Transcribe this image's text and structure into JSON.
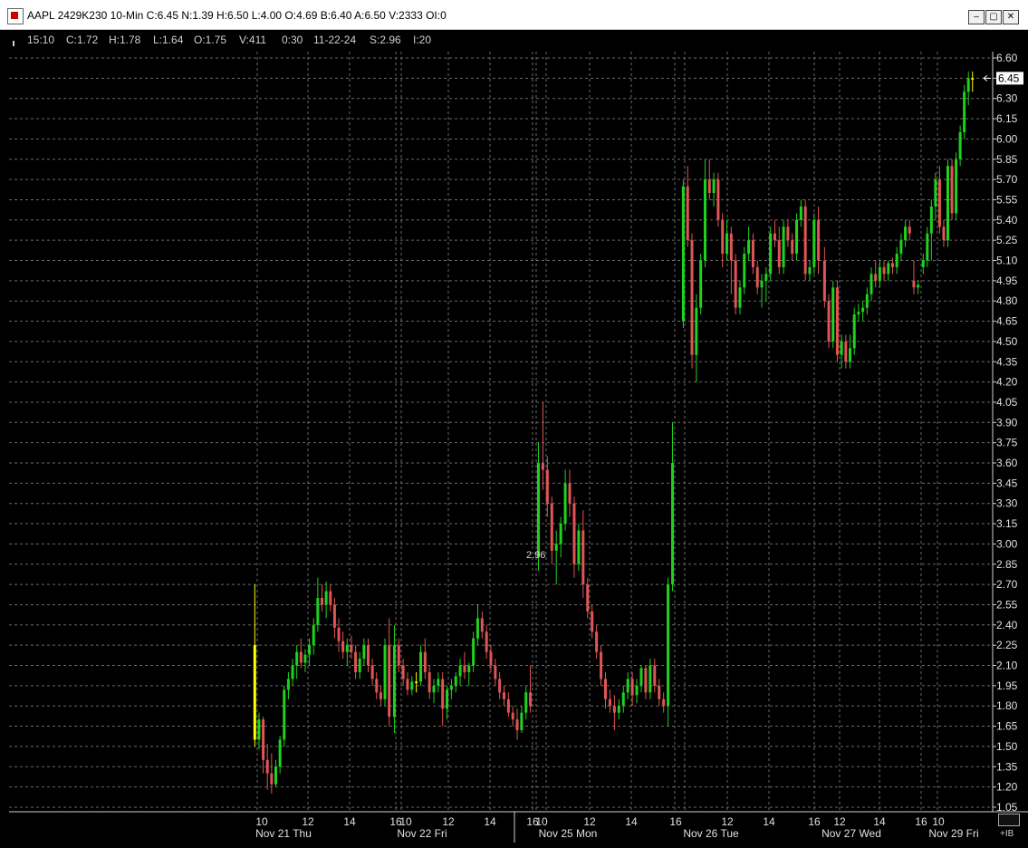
{
  "window": {
    "title": "AAPL 2429K230 10-Min C:6.45 N:1.39 H:6.50 L:4.00 O:4.69 B:6.40 A:6.50 V:2333 OI:0",
    "buttons": {
      "minimize": "‒",
      "maximize": "▢",
      "close": "✕"
    }
  },
  "info": {
    "time": "15:10",
    "close": "C:1.72",
    "high": "H:1.78",
    "low": "L:1.64",
    "open": "O:1.75",
    "volume": "V:411",
    "bar_interval": "0:30",
    "date": "11-22-24",
    "settle": "S:2.96",
    "index": "I:20"
  },
  "corner": {
    "label": "+IB"
  },
  "chart_data": {
    "type": "candlestick",
    "title": "",
    "xlabel": "",
    "ylabel": "",
    "ylim": [
      1.0,
      6.65
    ],
    "y_ticks": [
      "6.60",
      "6.45",
      "6.30",
      "6.15",
      "6.00",
      "5.85",
      "5.70",
      "5.55",
      "5.40",
      "5.25",
      "5.10",
      "4.95",
      "4.80",
      "4.65",
      "4.50",
      "4.35",
      "4.20",
      "4.05",
      "3.90",
      "3.75",
      "3.60",
      "3.45",
      "3.30",
      "3.15",
      "3.00",
      "2.85",
      "2.70",
      "2.55",
      "2.40",
      "2.25",
      "2.10",
      "1.95",
      "1.80",
      "1.65",
      "1.50",
      "1.35",
      "1.20",
      "1.05"
    ],
    "last_price": "6.45",
    "annotation": "2.96",
    "colors": {
      "up": "#1ed31e",
      "down": "#e05555",
      "doji": "#ffff00",
      "grid": "#6a6a6a",
      "text": "#e0e0e0"
    },
    "x_time_labels": [
      "10",
      "12",
      "14",
      "16",
      "10",
      "12",
      "14",
      "16",
      "10",
      "12",
      "14",
      "16",
      "12",
      "14",
      "16",
      "12",
      "14",
      "16",
      "10"
    ],
    "x_day_labels": [
      "Nov 21 Thu",
      "Nov 22 Fri",
      "Nov 25 Mon",
      "Nov 26 Tue",
      "Nov 27 Wed",
      "Nov 29 Fri"
    ],
    "sessions": [
      {
        "name": "Nov 21 Thu",
        "bars": [
          [
            2.25,
            2.7,
            1.5,
            1.55
          ],
          [
            1.55,
            1.75,
            1.48,
            1.7
          ],
          [
            1.7,
            1.72,
            1.3,
            1.4
          ],
          [
            1.4,
            1.52,
            1.18,
            1.3
          ],
          [
            1.3,
            1.45,
            1.15,
            1.22
          ],
          [
            1.22,
            1.4,
            1.2,
            1.35
          ],
          [
            1.35,
            1.58,
            1.3,
            1.55
          ],
          [
            1.55,
            1.95,
            1.5,
            1.92
          ],
          [
            1.92,
            2.05,
            1.85,
            2.0
          ],
          [
            2.0,
            2.15,
            1.95,
            2.1
          ],
          [
            2.1,
            2.25,
            2.0,
            2.2
          ],
          [
            2.2,
            2.3,
            2.08,
            2.12
          ],
          [
            2.12,
            2.22,
            2.05,
            2.18
          ],
          [
            2.18,
            2.3,
            2.1,
            2.25
          ],
          [
            2.25,
            2.45,
            2.18,
            2.4
          ],
          [
            2.4,
            2.75,
            2.35,
            2.6
          ],
          [
            2.6,
            2.7,
            2.5,
            2.55
          ],
          [
            2.55,
            2.72,
            2.45,
            2.65
          ],
          [
            2.65,
            2.7,
            2.5,
            2.55
          ],
          [
            2.55,
            2.6,
            2.3,
            2.38
          ],
          [
            2.38,
            2.45,
            2.2,
            2.28
          ],
          [
            2.28,
            2.35,
            2.15,
            2.2
          ],
          [
            2.2,
            2.3,
            2.1,
            2.25
          ],
          [
            2.25,
            2.32,
            2.15,
            2.2
          ],
          [
            2.2,
            2.25,
            2.0,
            2.05
          ],
          [
            2.05,
            2.2,
            2.0,
            2.15
          ],
          [
            2.15,
            2.3,
            2.1,
            2.25
          ],
          [
            2.25,
            2.3,
            2.05,
            2.1
          ],
          [
            2.1,
            2.15,
            1.95,
            2.0
          ],
          [
            2.0,
            2.05,
            1.85,
            1.9
          ],
          [
            1.9,
            1.95,
            1.8,
            1.85
          ],
          [
            1.85,
            2.3,
            1.8,
            2.25
          ],
          [
            2.25,
            2.45,
            1.65,
            1.72
          ]
        ]
      },
      {
        "name": "Nov 22 Fri",
        "bars": [
          [
            1.72,
            2.4,
            1.6,
            2.25
          ],
          [
            2.25,
            2.3,
            2.05,
            2.1
          ],
          [
            2.1,
            2.15,
            1.95,
            2.0
          ],
          [
            2.0,
            2.05,
            1.88,
            1.92
          ],
          [
            1.92,
            2.02,
            1.88,
            1.98
          ],
          [
            1.98,
            2.05,
            1.9,
            1.98
          ],
          [
            1.98,
            2.25,
            1.95,
            2.2
          ],
          [
            2.2,
            2.3,
            2.0,
            2.05
          ],
          [
            2.05,
            2.1,
            1.85,
            1.9
          ],
          [
            1.9,
            2.0,
            1.82,
            1.95
          ],
          [
            1.95,
            2.05,
            1.9,
            2.0
          ],
          [
            2.0,
            2.05,
            1.65,
            1.78
          ],
          [
            1.78,
            1.95,
            1.7,
            1.92
          ],
          [
            1.92,
            2.0,
            1.85,
            1.95
          ],
          [
            1.95,
            2.05,
            1.9,
            2.02
          ],
          [
            2.02,
            2.15,
            1.95,
            2.1
          ],
          [
            2.1,
            2.2,
            2.0,
            2.05
          ],
          [
            2.05,
            2.12,
            1.95,
            2.1
          ],
          [
            2.1,
            2.35,
            2.05,
            2.3
          ],
          [
            2.3,
            2.55,
            2.25,
            2.45
          ],
          [
            2.45,
            2.5,
            2.3,
            2.35
          ],
          [
            2.35,
            2.4,
            2.15,
            2.2
          ],
          [
            2.2,
            2.25,
            2.05,
            2.1
          ],
          [
            2.1,
            2.15,
            1.95,
            2.0
          ],
          [
            2.0,
            2.05,
            1.85,
            1.9
          ],
          [
            1.9,
            1.95,
            1.8,
            1.85
          ],
          [
            1.85,
            1.9,
            1.72,
            1.75
          ],
          [
            1.75,
            1.8,
            1.65,
            1.7
          ],
          [
            1.7,
            1.78,
            1.55,
            1.62
          ],
          [
            1.62,
            1.8,
            1.6,
            1.75
          ],
          [
            1.75,
            1.95,
            1.7,
            1.9
          ],
          [
            1.9,
            2.1,
            1.75,
            1.8
          ]
        ]
      },
      {
        "name": "Nov 25 Mon",
        "bars": [
          [
            2.9,
            3.75,
            2.8,
            3.6
          ],
          [
            3.6,
            4.05,
            3.4,
            3.55
          ],
          [
            3.55,
            3.65,
            3.2,
            3.3
          ],
          [
            3.3,
            3.35,
            2.85,
            2.95
          ],
          [
            2.95,
            3.1,
            2.7,
            3.0
          ],
          [
            3.0,
            3.2,
            2.9,
            3.15
          ],
          [
            3.15,
            3.55,
            3.1,
            3.45
          ],
          [
            3.45,
            3.55,
            3.2,
            3.3
          ],
          [
            3.3,
            3.35,
            2.75,
            2.85
          ],
          [
            2.85,
            3.15,
            2.8,
            3.1
          ],
          [
            3.1,
            3.25,
            2.6,
            2.7
          ],
          [
            2.7,
            2.75,
            2.45,
            2.5
          ],
          [
            2.5,
            2.55,
            2.3,
            2.35
          ],
          [
            2.35,
            2.4,
            2.15,
            2.2
          ],
          [
            2.2,
            2.25,
            1.95,
            2.0
          ],
          [
            2.0,
            2.05,
            1.78,
            1.85
          ],
          [
            1.85,
            1.92,
            1.75,
            1.8
          ],
          [
            1.8,
            1.88,
            1.62,
            1.75
          ],
          [
            1.75,
            1.85,
            1.7,
            1.8
          ],
          [
            1.8,
            1.95,
            1.75,
            1.9
          ],
          [
            1.9,
            2.05,
            1.85,
            2.0
          ],
          [
            2.0,
            2.05,
            1.8,
            1.88
          ],
          [
            1.88,
            2.0,
            1.82,
            1.95
          ],
          [
            1.95,
            2.1,
            1.9,
            2.08
          ],
          [
            2.08,
            2.1,
            1.85,
            1.9
          ],
          [
            1.9,
            2.15,
            1.85,
            2.1
          ],
          [
            2.1,
            2.15,
            1.9,
            1.95
          ],
          [
            1.95,
            2.0,
            1.8,
            1.85
          ],
          [
            1.85,
            1.9,
            1.75,
            1.8
          ],
          [
            1.8,
            2.75,
            1.65,
            2.7
          ],
          [
            2.7,
            3.9,
            2.65,
            3.6
          ]
        ]
      },
      {
        "name": "Nov 26 Tue",
        "bars": [
          [
            4.65,
            5.7,
            4.6,
            5.65
          ],
          [
            5.65,
            5.8,
            5.2,
            5.25
          ],
          [
            5.25,
            5.3,
            4.3,
            4.4
          ],
          [
            4.4,
            4.85,
            4.2,
            4.75
          ],
          [
            4.75,
            5.15,
            4.7,
            5.1
          ],
          [
            5.1,
            5.85,
            5.05,
            5.7
          ],
          [
            5.7,
            5.85,
            5.55,
            5.6
          ],
          [
            5.6,
            5.75,
            5.5,
            5.7
          ],
          [
            5.7,
            5.75,
            5.35,
            5.4
          ],
          [
            5.4,
            5.45,
            5.05,
            5.15
          ],
          [
            5.15,
            5.4,
            5.1,
            5.3
          ],
          [
            5.3,
            5.35,
            4.85,
            5.1
          ],
          [
            5.1,
            5.15,
            4.7,
            4.75
          ],
          [
            4.75,
            4.95,
            4.7,
            4.9
          ],
          [
            4.9,
            5.2,
            4.85,
            5.15
          ],
          [
            5.15,
            5.35,
            5.1,
            5.25
          ],
          [
            5.25,
            5.3,
            5.0,
            5.05
          ],
          [
            5.05,
            5.1,
            4.85,
            4.9
          ],
          [
            4.9,
            5.0,
            4.75,
            4.95
          ],
          [
            4.95,
            5.05,
            4.8,
            5.0
          ],
          [
            5.0,
            5.35,
            4.95,
            5.3
          ],
          [
            5.3,
            5.4,
            5.2,
            5.25
          ],
          [
            5.25,
            5.35,
            5.0,
            5.05
          ],
          [
            5.05,
            5.4,
            5.0,
            5.35
          ],
          [
            5.35,
            5.4,
            5.2,
            5.25
          ],
          [
            5.25,
            5.3,
            5.1,
            5.15
          ],
          [
            5.15,
            5.45,
            5.1,
            5.4
          ],
          [
            5.4,
            5.55,
            5.35,
            5.5
          ],
          [
            5.5,
            5.55,
            4.95,
            5.0
          ],
          [
            5.0,
            5.1,
            4.95,
            5.05
          ],
          [
            5.05,
            5.45,
            5.0,
            5.4
          ],
          [
            5.4,
            5.5,
            5.0,
            5.1
          ]
        ]
      },
      {
        "name": "Nov 27 Wed",
        "bars": [
          [
            5.1,
            5.2,
            4.75,
            4.8
          ],
          [
            4.8,
            4.85,
            4.45,
            4.5
          ],
          [
            4.5,
            4.95,
            4.45,
            4.9
          ],
          [
            4.9,
            4.95,
            4.35,
            4.4
          ],
          [
            4.4,
            4.55,
            4.3,
            4.5
          ],
          [
            4.5,
            4.55,
            4.3,
            4.35
          ],
          [
            4.35,
            4.55,
            4.3,
            4.45
          ],
          [
            4.45,
            4.75,
            4.4,
            4.7
          ],
          [
            4.7,
            4.78,
            4.65,
            4.72
          ],
          [
            4.72,
            4.8,
            4.65,
            4.75
          ],
          [
            4.75,
            4.9,
            4.7,
            4.85
          ],
          [
            4.85,
            5.05,
            4.8,
            5.0
          ],
          [
            5.0,
            5.1,
            4.9,
            4.95
          ],
          [
            4.95,
            5.1,
            4.9,
            5.05
          ],
          [
            5.05,
            5.1,
            4.95,
            5.0
          ],
          [
            5.0,
            5.1,
            4.95,
            5.08
          ],
          [
            5.08,
            5.12,
            5.0,
            5.05
          ],
          [
            5.05,
            5.2,
            5.0,
            5.15
          ],
          [
            5.15,
            5.3,
            5.1,
            5.25
          ],
          [
            5.25,
            5.4,
            5.2,
            5.35
          ],
          [
            5.35,
            5.4,
            5.25,
            5.3
          ],
          [
            4.95,
            5.1,
            4.85,
            4.9
          ],
          [
            4.9,
            4.95,
            4.85,
            4.92
          ]
        ]
      },
      {
        "name": "Nov 29 Fri",
        "bars": [
          [
            5.05,
            5.15,
            5.0,
            5.1
          ],
          [
            5.1,
            5.35,
            5.05,
            5.3
          ],
          [
            5.3,
            5.55,
            5.1,
            5.5
          ],
          [
            5.5,
            5.75,
            5.4,
            5.7
          ],
          [
            5.7,
            5.8,
            5.3,
            5.35
          ],
          [
            5.35,
            5.4,
            5.2,
            5.25
          ],
          [
            5.25,
            5.85,
            5.2,
            5.8
          ],
          [
            5.8,
            5.85,
            5.4,
            5.45
          ],
          [
            5.45,
            5.9,
            5.4,
            5.85
          ],
          [
            5.85,
            6.1,
            5.8,
            6.05
          ],
          [
            6.05,
            6.4,
            6.0,
            6.35
          ],
          [
            6.35,
            6.5,
            6.25,
            6.45
          ],
          [
            6.45,
            6.5,
            6.35,
            6.45
          ]
        ]
      }
    ]
  }
}
